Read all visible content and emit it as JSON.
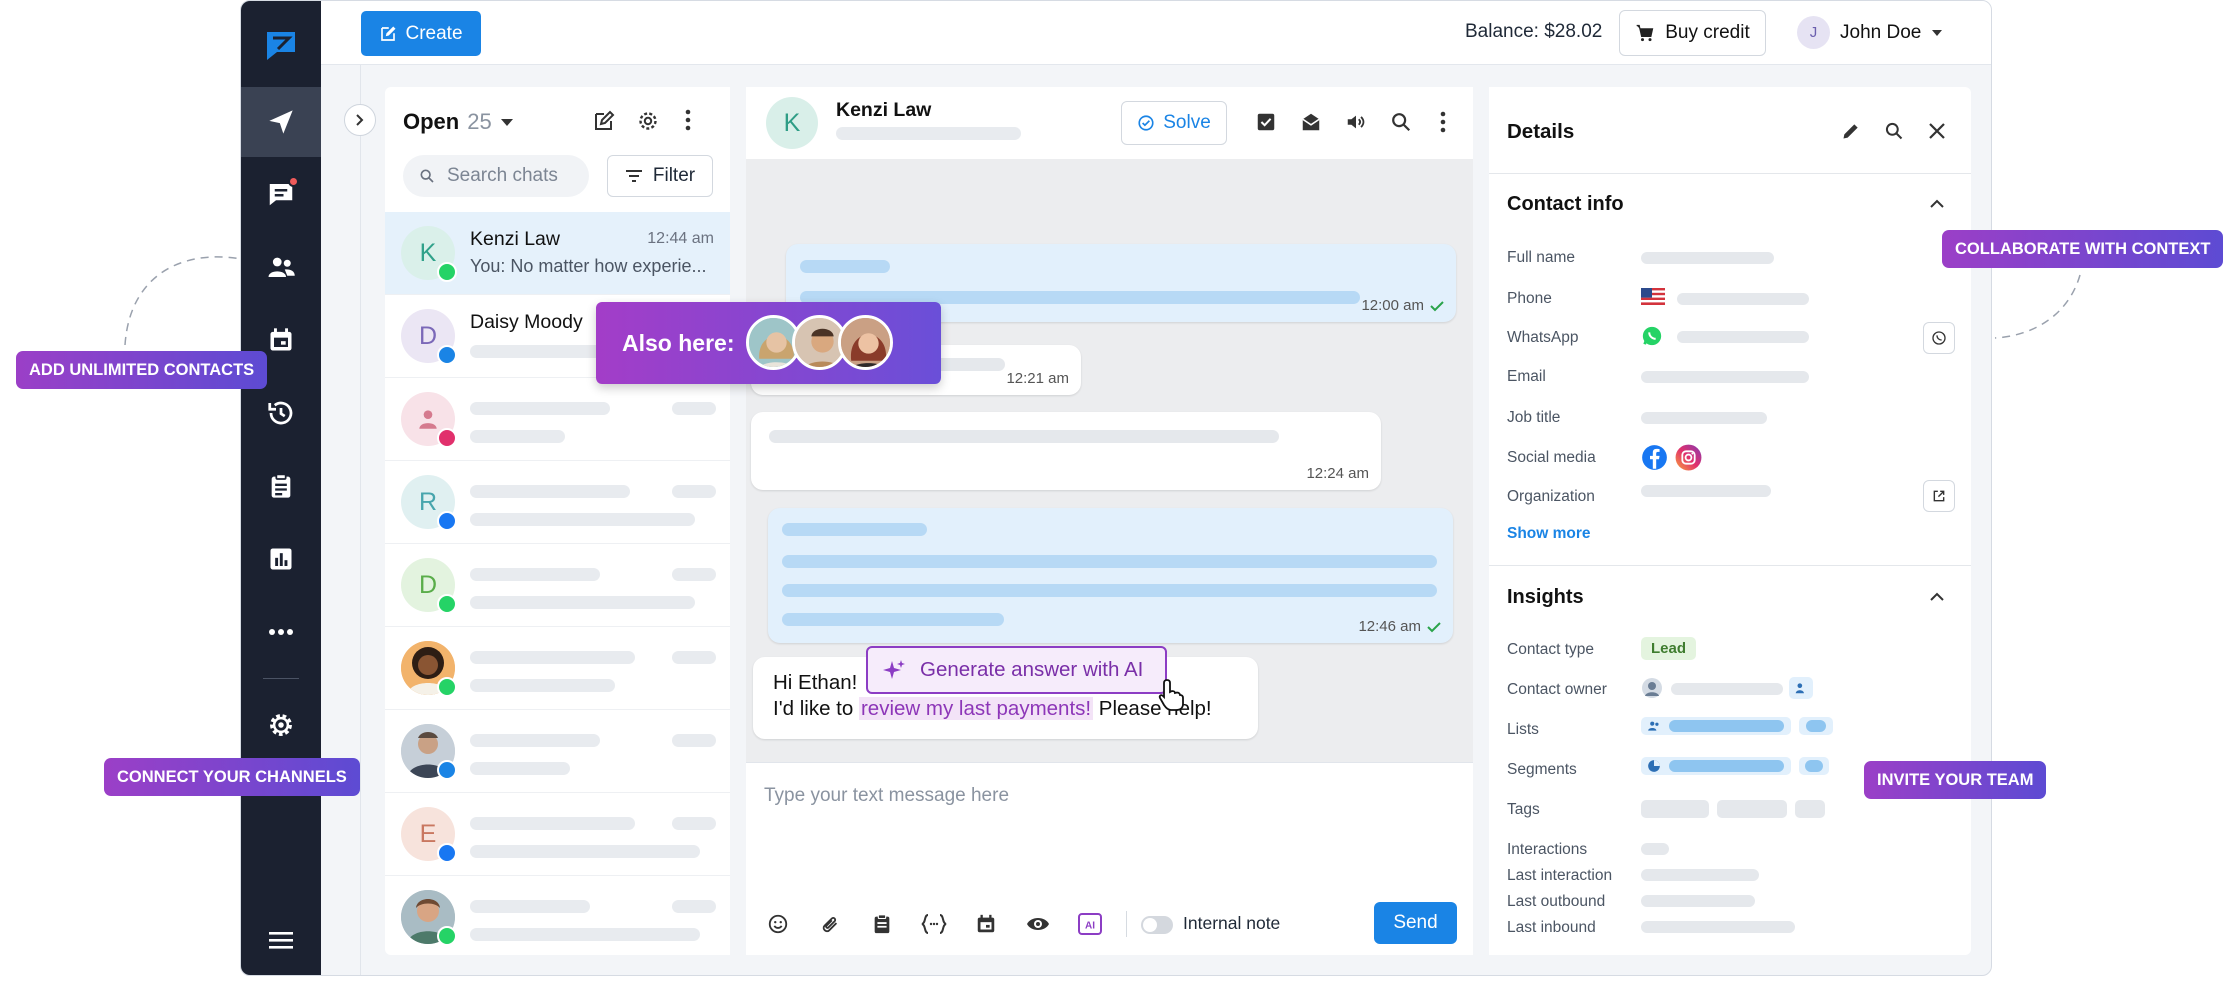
{
  "topbar": {
    "create_label": "Create",
    "balance": "Balance: $28.02",
    "buy_credit_label": "Buy credit",
    "user_initial": "J",
    "user_name": "John Doe"
  },
  "chat_list": {
    "filter_title": "Open",
    "count": "25",
    "search_placeholder": "Search chats",
    "filter_label": "Filter",
    "rows": [
      {
        "initial": "K",
        "name": "Kenzi Law",
        "time": "12:44 am",
        "preview": "You: No matter how experie...",
        "channel": "whatsapp"
      },
      {
        "initial": "D",
        "name": "Daisy Moody",
        "channel": "chat"
      },
      {
        "initial": "",
        "channel": "instagram"
      },
      {
        "initial": "R",
        "channel": "facebook"
      },
      {
        "initial": "D",
        "channel": "whatsapp"
      },
      {
        "initial": "",
        "channel": "whatsapp"
      },
      {
        "initial": "",
        "channel": "chat"
      },
      {
        "initial": "E",
        "channel": "facebook"
      },
      {
        "initial": "",
        "channel": "whatsapp"
      }
    ]
  },
  "conversation": {
    "contact_initial": "K",
    "contact_name": "Kenzi Law",
    "solve_label": "Solve",
    "messages": [
      {
        "time": "12:00 am"
      },
      {
        "time": "12:21 am"
      },
      {
        "time": "12:24 am"
      },
      {
        "time": "12:46 am"
      }
    ],
    "incoming_line1": "Hi Ethan!",
    "incoming_line2_pre": "I'd like to",
    "incoming_highlight": "review my last payments!",
    "incoming_line2_post": "Please help!",
    "ai_button_label": "Generate answer with AI",
    "composer_placeholder": "Type your text message here",
    "internal_note_label": "Internal note",
    "send_label": "Send"
  },
  "details": {
    "title": "Details",
    "contact_info_title": "Contact info",
    "fields": [
      "Full name",
      "Phone",
      "WhatsApp",
      "Email",
      "Job title",
      "Social media",
      "Organization"
    ],
    "show_more": "Show more",
    "insights_title": "Insights",
    "insights_fields": [
      "Contact type",
      "Contact owner",
      "Lists",
      "Segments",
      "Tags",
      "Interactions",
      "Last interaction",
      "Last outbound",
      "Last inbound"
    ],
    "contact_type_value": "Lead"
  },
  "overlays": {
    "also_here": "Also here:",
    "add_contacts": "ADD UNLIMITED CONTACTS",
    "connect_channels": "CONNECT YOUR CHANNELS",
    "collaborate": "COLLABORATE WITH CONTEXT",
    "invite_team": "INVITE YOUR TEAM"
  },
  "colors": {
    "primary": "#1a84e5",
    "sidebar": "#1b2130",
    "accent_purple": "#8c3dc4",
    "whatsapp": "#25d366",
    "facebook": "#1877f2",
    "instagram": "#e1306c"
  }
}
